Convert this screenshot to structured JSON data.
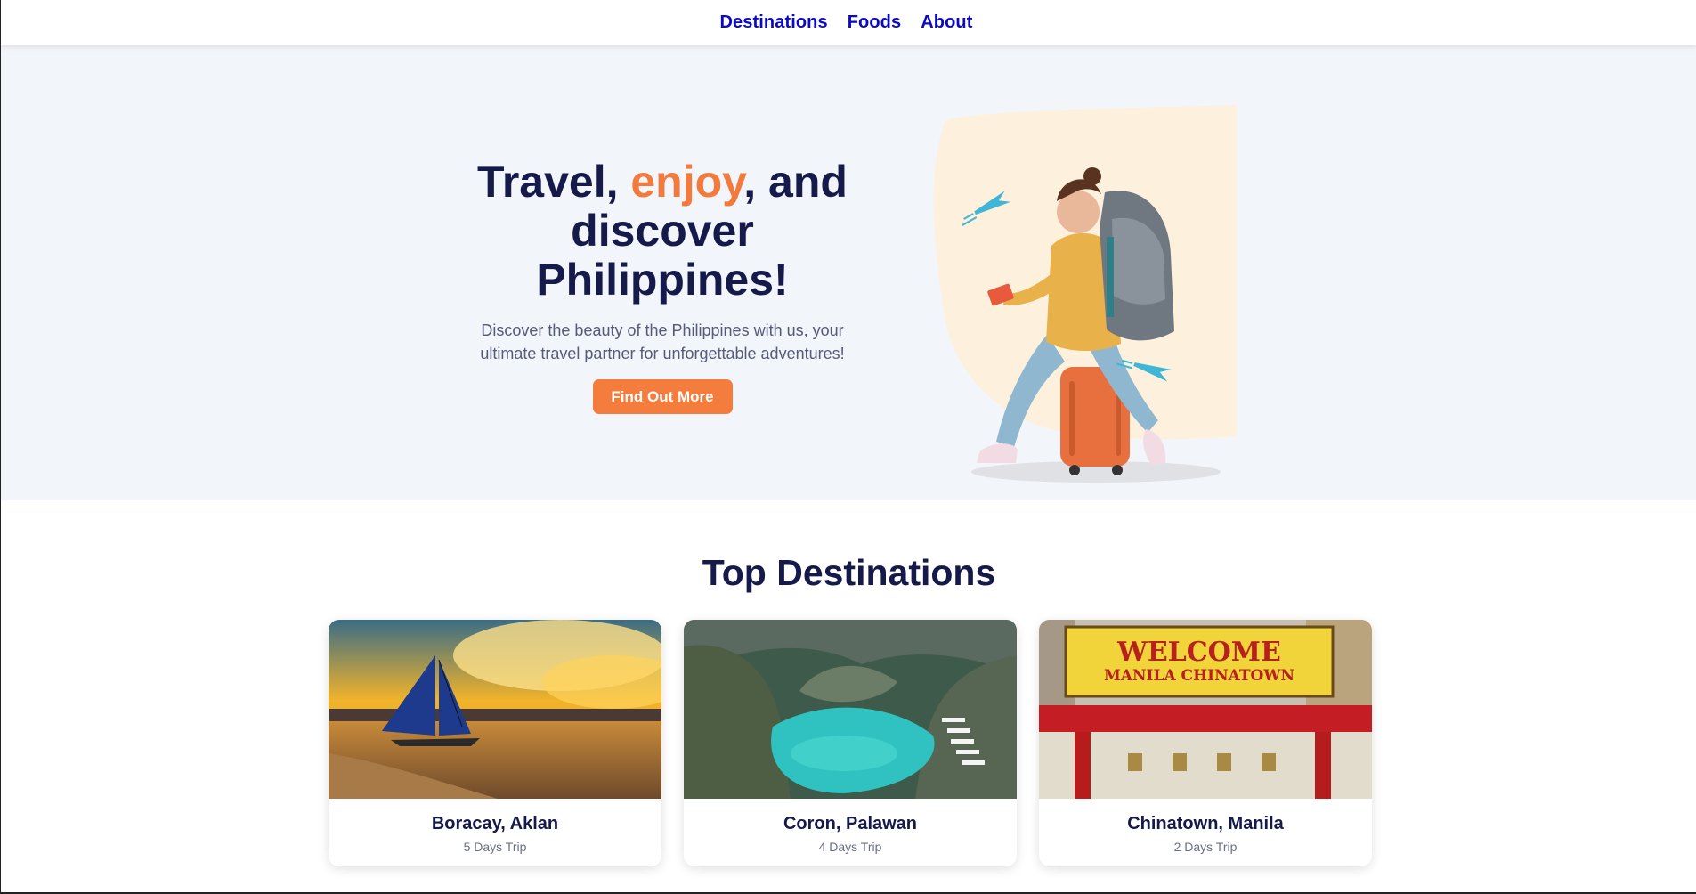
{
  "nav": {
    "links": [
      "Destinations",
      "Foods",
      "About"
    ]
  },
  "hero": {
    "title_part1": "Travel, ",
    "title_accent": "enjoy",
    "title_part2": ", and discover Philippines!",
    "subtitle": "Discover the beauty of the Philippines with us, your ultimate travel partner for unforgettable adventures!",
    "cta_label": "Find Out More"
  },
  "destinations": {
    "title": "Top Destinations",
    "cards": [
      {
        "name": "Boracay, Aklan",
        "trip": "5 Days Trip"
      },
      {
        "name": "Coron, Palawan",
        "trip": "4 Days Trip"
      },
      {
        "name": "Chinatown, Manila",
        "trip": "2 Days Trip"
      }
    ],
    "chinatown_sign": {
      "line1": "WELCOME",
      "line2": "MANILA CHINATOWN"
    }
  },
  "colors": {
    "nav_link": "#0a09c8",
    "heading": "#151a4b",
    "accent": "#f27a3c",
    "hero_bg": "#f2f5f9",
    "button": "#f47d3e"
  }
}
